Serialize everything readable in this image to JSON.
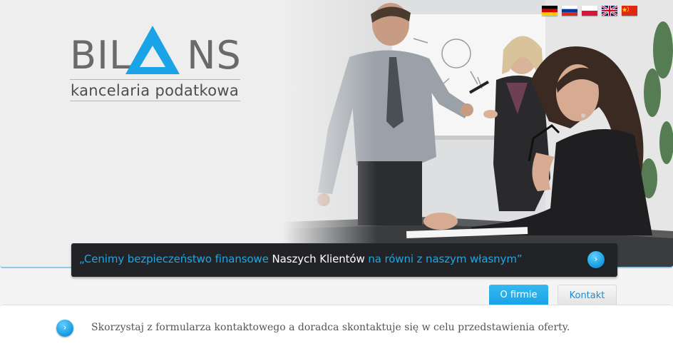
{
  "brand": {
    "name_part1": "BIL",
    "name_part2": "NS",
    "tagline": "kancelaria podatkowa",
    "logo_color": "#6a6a6a",
    "accent_color": "#1aa3e6"
  },
  "flags": [
    {
      "lang": "German",
      "icon": "flag-de-icon"
    },
    {
      "lang": "Russian",
      "icon": "flag-ru-icon"
    },
    {
      "lang": "Polish",
      "icon": "flag-pl-icon"
    },
    {
      "lang": "English",
      "icon": "flag-gb-icon"
    },
    {
      "lang": "Chinese",
      "icon": "flag-cn-icon"
    }
  ],
  "hero": {
    "image": "business-meeting-photo"
  },
  "quote": {
    "part1": "„Cenimy bezpieczeństwo finansowe ",
    "highlight": "Naszych Klientów",
    "part2": " na równi z naszym własnym”",
    "button_icon": "chevron-right-icon"
  },
  "tabs": [
    {
      "label": "O firmie",
      "active": true
    },
    {
      "label": "Kontakt",
      "active": false
    }
  ],
  "panel": {
    "button_icon": "chevron-right-icon",
    "text": "Skorzystaj z formularza kontaktowego a doradca skontaktuje się w celu przedstawienia oferty."
  }
}
